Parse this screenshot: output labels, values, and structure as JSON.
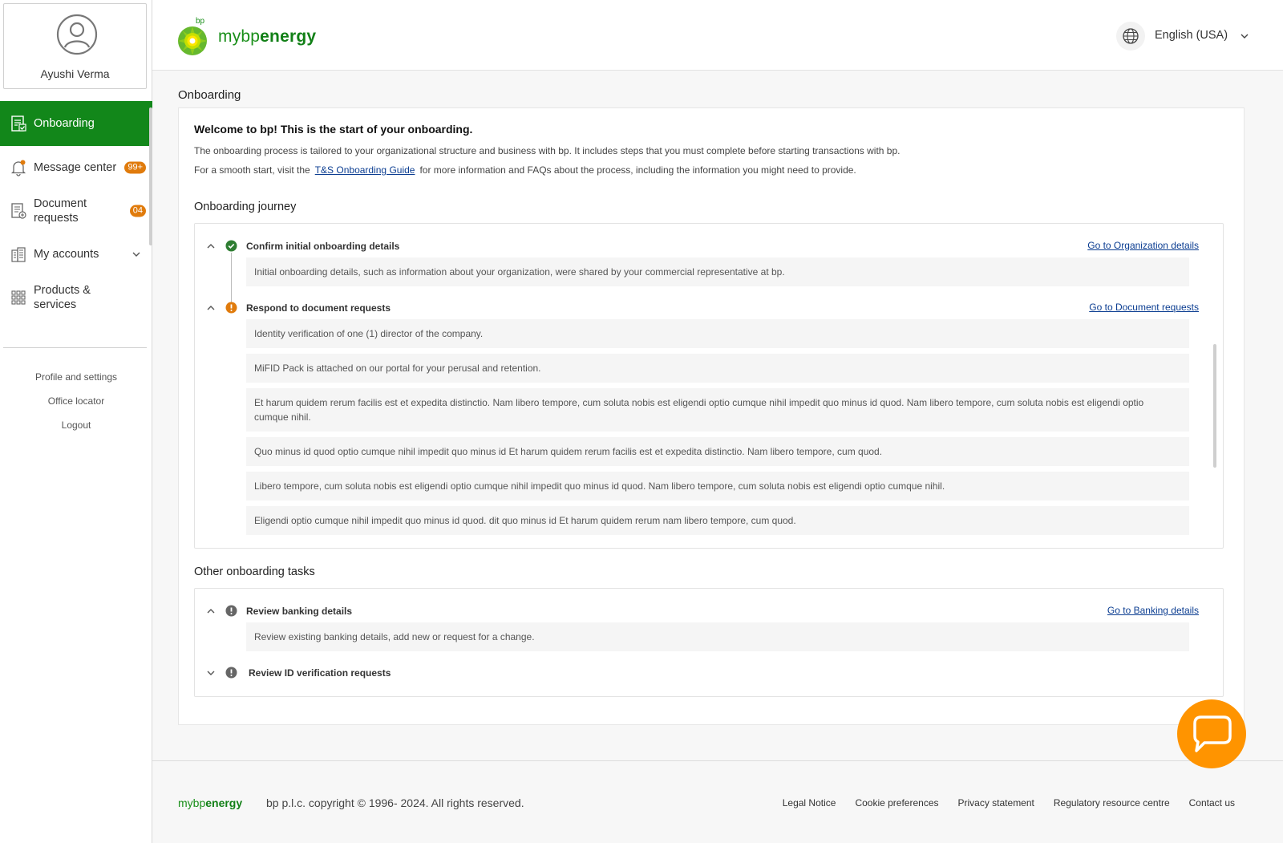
{
  "sidebar": {
    "profile_name": "Ayushi Verma",
    "nav": [
      {
        "label": "Onboarding",
        "icon": "document-check-icon",
        "active": true
      },
      {
        "label": "Message center",
        "icon": "bell-icon",
        "badge": "99+"
      },
      {
        "label": "Document requests",
        "icon": "document-request-icon",
        "badge": "04"
      },
      {
        "label": "My accounts",
        "icon": "buildings-icon"
      },
      {
        "label": "Products & services",
        "icon": "grid-icon"
      }
    ],
    "links": [
      "Profile and settings",
      "Office locator",
      "Logout"
    ]
  },
  "header": {
    "brand_prefix": "mybp",
    "brand_suffix": "energy",
    "logo_text": "bp",
    "language": "English (USA)"
  },
  "main": {
    "page_title": "Onboarding",
    "welcome": "Welcome to bp! This is the start of your onboarding.",
    "intro_line1": "The onboarding process is tailored to your organizational structure and business with bp. It includes steps that you must complete before starting transactions with bp.",
    "intro_line2_pre": "For a smooth start, visit the",
    "intro_link": "T&S Onboarding Guide",
    "intro_line2_post": "for more information and FAQs about the process, including the information you might need to provide.",
    "journey_title": "Onboarding journey",
    "journey_steps": [
      {
        "title": "Confirm initial onboarding details",
        "status": "complete",
        "link": "Go to Organization details",
        "items": [
          "Initial onboarding details, such as information about your organization, were shared by your commercial representative at bp."
        ]
      },
      {
        "title": "Respond to document requests",
        "status": "warning",
        "link": "Go to Document requests",
        "items": [
          "Identity verification of one (1) director of the company.",
          "MiFID Pack is attached on our portal for your perusal and retention.",
          "Et harum quidem rerum facilis est et expedita distinctio. Nam libero tempore, cum soluta nobis est eligendi optio cumque nihil impedit quo minus id quod. Nam libero tempore, cum soluta nobis est eligendi optio cumque nihil.",
          "Quo minus id quod optio cumque nihil impedit quo minus id Et harum quidem rerum facilis est et expedita distinctio. Nam libero tempore, cum quod.",
          "Libero tempore, cum soluta nobis est eligendi optio cumque nihil impedit quo minus id quod. Nam libero tempore, cum soluta nobis est eligendi optio cumque nihil.",
          "Eligendi optio cumque nihil impedit quo minus id quod. dit quo minus id Et harum quidem rerum nam libero tempore, cum quod."
        ]
      }
    ],
    "other_title": "Other onboarding tasks",
    "other_steps": [
      {
        "title": "Review banking details",
        "status": "info",
        "link": "Go to Banking details",
        "items": [
          "Review existing banking details, add new or request for a change."
        ]
      },
      {
        "title": "Review ID verification requests",
        "status": "info",
        "collapsed": true
      }
    ]
  },
  "footer": {
    "brand_prefix": "mybp",
    "brand_suffix": "energy",
    "copyright": "bp p.l.c. copyright © 1996- 2024. All rights reserved.",
    "links": [
      "Legal Notice",
      "Cookie preferences",
      "Privacy statement",
      "Regulatory resource centre",
      "Contact us"
    ]
  },
  "colors": {
    "accent_green": "#12871a",
    "badge_orange": "#e07b0c",
    "chat_orange": "#ff9400",
    "link_blue": "#0b3d91"
  }
}
